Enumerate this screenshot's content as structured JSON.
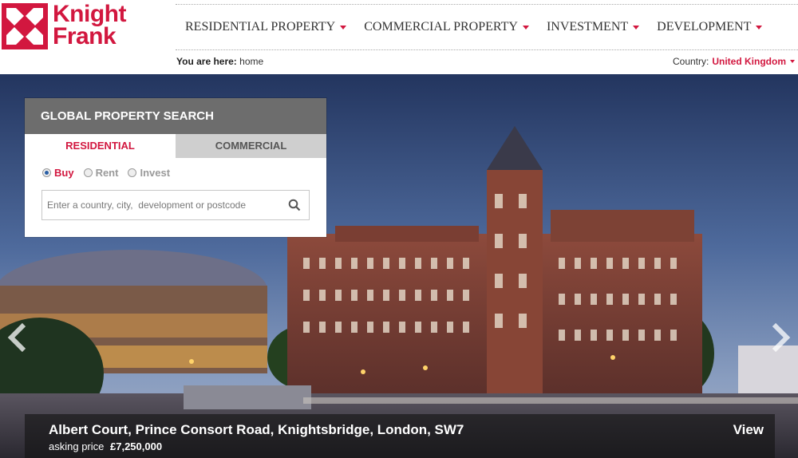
{
  "brand": {
    "line1": "Knight",
    "line2": "Frank",
    "color": "#d2173f"
  },
  "nav": [
    {
      "label": "RESIDENTIAL PROPERTY"
    },
    {
      "label": "COMMERCIAL PROPERTY"
    },
    {
      "label": "INVESTMENT"
    },
    {
      "label": "DEVELOPMENT"
    }
  ],
  "breadcrumb": {
    "prefix": "You are here:",
    "current": "home"
  },
  "country": {
    "label": "Country:",
    "value": "United Kingdom"
  },
  "search": {
    "title": "GLOBAL PROPERTY SEARCH",
    "tabs": {
      "residential": "RESIDENTIAL",
      "commercial": "COMMERCIAL"
    },
    "options": {
      "buy": "Buy",
      "rent": "Rent",
      "invest": "Invest"
    },
    "placeholder": "Enter a country, city,  development or postcode"
  },
  "listing": {
    "title": "Albert Court, Prince Consort Road, Knightsbridge, London, SW7",
    "price_label": "asking price",
    "price": "£7,250,000",
    "view_label": "View"
  }
}
